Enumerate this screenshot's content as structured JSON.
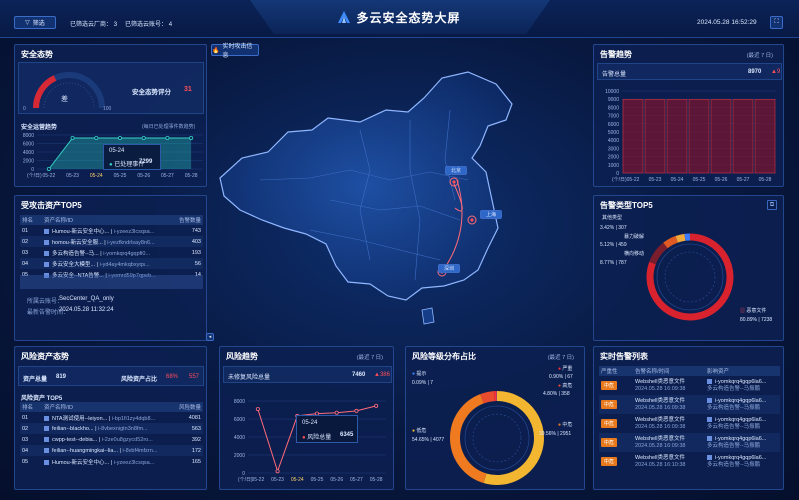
{
  "header": {
    "title": "多云安全态势大屏",
    "filter_label": "筛选",
    "vendor_label": "已筛选云厂商：",
    "vendor_count": "3",
    "account_label": "已筛选云账号：",
    "account_count": "4",
    "datetime": "2024.05.28 16:52:29"
  },
  "security_posture": {
    "title": "安全态势",
    "gauge_value_label": "差",
    "gauge_min": "0",
    "gauge_max": "100",
    "score_label": "安全态势评分",
    "score": "31",
    "trend_title": "安全运营趋势",
    "trend_note": "(每日已处理事件数趋势)",
    "tooltip_date": "05-24",
    "tooltip_label": "已处理事件",
    "tooltip_value": "7299"
  },
  "attacked_assets": {
    "title": "受攻击资产TOP5",
    "columns": [
      "排名",
      "资产名称/ID",
      "告警数量"
    ],
    "rows": [
      {
        "rank": "01",
        "name": "Humou-新云安全中心...",
        "id": "i-yzeez3lcsqsa...",
        "count": "743"
      },
      {
        "rank": "02",
        "name": "homou-新云安全服...",
        "id": "i-yezfkndrlsay8n6...",
        "count": "403"
      },
      {
        "rank": "03",
        "name": "多云构造告警--马...",
        "id": "i-yomkqrq4gqpfi0...",
        "count": "193"
      },
      {
        "rank": "04",
        "name": "多云安全大模型...",
        "id": "i-yd4ay4mkqbxyqs...",
        "count": "56"
      },
      {
        "rank": "05",
        "name": "多云安全--NTA告警...",
        "id": "i-yomrd59p7qpeb...",
        "count": "14"
      }
    ],
    "detail_account_label": "所属云账号：",
    "detail_account": "SecCenter_QA_only",
    "detail_time_label": "最新告警时间：",
    "detail_time": "2024.05.28 11:32:24"
  },
  "map": {
    "realtime_button": "实时攻击信息",
    "city_labels": [
      "北京",
      "上海",
      "深圳"
    ]
  },
  "alert_trend": {
    "title": "告警趋势",
    "range": "(最近 7 日)",
    "total_label": "告警总量",
    "total_value": "8970",
    "change": "9"
  },
  "alert_type": {
    "title": "告警类型TOP5",
    "legend": [
      {
        "label": "其他类型",
        "pct": "",
        "count": ""
      },
      {
        "label": "暴力破解",
        "pct": "3.42%",
        "count": "307"
      },
      {
        "label": "横向移动",
        "pct": "5.12%",
        "count": "459"
      },
      {
        "label": "",
        "pct": "8.77%",
        "count": "787"
      },
      {
        "label": "恶意文件",
        "pct": "80.89%",
        "count": "7238"
      }
    ]
  },
  "risk_posture": {
    "title": "风险资产态势",
    "total_label": "资产总量",
    "total_value": "819",
    "ratio_label": "风险资产占比",
    "ratio_pct": "68%",
    "ratio_count": "557",
    "top_title": "风险资产 TOP5",
    "columns": [
      "排名",
      "资产名称/ID",
      "风险数量"
    ],
    "rows": [
      {
        "rank": "01",
        "name": "NTA测试使用--leiyon...",
        "id": "i-bp1fi1zy4dqb8...",
        "count": "4081"
      },
      {
        "rank": "02",
        "name": "feilian--blackho...",
        "id": "i-8vbexnigtn3n8fm...",
        "count": "563"
      },
      {
        "rank": "03",
        "name": "cwpp-test--debia...",
        "id": "i-2ze0u8gzycd52ro...",
        "count": "392"
      },
      {
        "rank": "04",
        "name": "feilian--huangmingkai--lia...",
        "id": "i-8vbf4mfzrn...",
        "count": "172"
      },
      {
        "rank": "05",
        "name": "Humou-新云安全中心...",
        "id": "i-yzeez3lcsqsa...",
        "count": "165"
      }
    ]
  },
  "risk_trend": {
    "title": "风险趋势",
    "range": "(最近 7 日)",
    "total_label": "未修复风险总量",
    "total_value": "7460",
    "change": "386",
    "tooltip_date": "05-24",
    "tooltip_label": "风险总量",
    "tooltip_value": "6345"
  },
  "risk_level": {
    "title": "风险等级分布占比",
    "range": "(最近 7 日)",
    "legend": [
      {
        "label": "提示",
        "pct": "0.09%",
        "count": "7"
      },
      {
        "label": "严重",
        "pct": "0.90%",
        "count": "67"
      },
      {
        "label": "高危",
        "pct": "4.80%",
        "count": "358"
      },
      {
        "label": "中危",
        "pct": "39.56%",
        "count": "2951"
      },
      {
        "label": "低危",
        "pct": "54.65%",
        "count": "4077"
      }
    ]
  },
  "realtime_alerts": {
    "title": "实时告警列表",
    "columns": [
      "严重性",
      "告警名称/时间",
      "影响资产"
    ],
    "rows": [
      {
        "severity": "中危",
        "name": "Webshell类恶意文件",
        "time": "2024.05.28 16:09:38",
        "asset": "i-yomkqrq4gqp6la6...",
        "asset2": "多云构造告警--马振鹏"
      },
      {
        "severity": "中危",
        "name": "Webshell类恶意文件",
        "time": "2024.05.28 16:09:38",
        "asset": "i-yomkqrq4gqp6la6...",
        "asset2": "多云构造告警--马振鹏"
      },
      {
        "severity": "中危",
        "name": "Webshell类恶意文件",
        "time": "2024.05.28 16:09:38",
        "asset": "i-yomkqrq4gqp6la6...",
        "asset2": "多云构造告警--马振鹏"
      },
      {
        "severity": "中危",
        "name": "Webshell类恶意文件",
        "time": "2024.05.28 16:09:38",
        "asset": "i-yomkqrq4gqp6la6...",
        "asset2": "多云构造告警--马振鹏"
      },
      {
        "severity": "中危",
        "name": "Webshell类恶意文件",
        "time": "2024.05.28 16:10:38",
        "asset": "i-yomkqrq4gqp6la6...",
        "asset2": "多云构造告警--马振鹏"
      }
    ]
  },
  "chart_data": [
    {
      "type": "area",
      "title": "安全运营趋势",
      "xlabel": "(个/日)",
      "categories": [
        "05-22",
        "05-23",
        "05-24",
        "05-25",
        "05-26",
        "05-27",
        "05-28"
      ],
      "values": [
        0,
        7299,
        7299,
        7299,
        7299,
        7299,
        7299
      ],
      "yticks": [
        "8000",
        "6000",
        "4000",
        "2000",
        "0"
      ],
      "ylim": [
        0,
        8000
      ]
    },
    {
      "type": "bar",
      "title": "告警趋势",
      "xlabel": "(个/日)",
      "categories": [
        "05-22",
        "05-23",
        "05-24",
        "05-25",
        "05-26",
        "05-27",
        "05-28"
      ],
      "values": [
        8970,
        8970,
        8970,
        8970,
        8970,
        8970,
        8970
      ],
      "yticks": [
        "10000",
        "9000",
        "8000",
        "7000",
        "6000",
        "5000",
        "4000",
        "3000",
        "2000",
        "1000",
        "0"
      ],
      "ylim": [
        0,
        10000
      ]
    },
    {
      "type": "line",
      "title": "风险趋势",
      "xlabel": "(个/日)",
      "categories": [
        "05-22",
        "05-23",
        "05-24",
        "05-25",
        "05-26",
        "05-27",
        "05-28"
      ],
      "values": [
        7100,
        200,
        6345,
        6600,
        6700,
        6900,
        7460
      ],
      "yticks": [
        "8000",
        "6000",
        "4000",
        "2000",
        "0"
      ],
      "ylim": [
        0,
        8000
      ]
    },
    {
      "type": "pie",
      "title": "告警类型TOP5",
      "labels": [
        "恶意文件",
        "其他",
        "横向移动",
        "暴力破解",
        "其他类型"
      ],
      "values": [
        7238,
        787,
        459,
        307,
        179
      ],
      "colors": [
        "#d8232f",
        "#7a1d2c",
        "#e05a24",
        "#f0a93b",
        "#3d7bff"
      ]
    },
    {
      "type": "pie",
      "title": "风险等级分布占比",
      "labels": [
        "低危",
        "中危",
        "高危",
        "严重",
        "提示"
      ],
      "values": [
        4077,
        2951,
        358,
        67,
        7
      ],
      "colors": [
        "#f2b630",
        "#ef7a1f",
        "#e84b2e",
        "#ff2d3d",
        "#3d8bff"
      ]
    }
  ]
}
